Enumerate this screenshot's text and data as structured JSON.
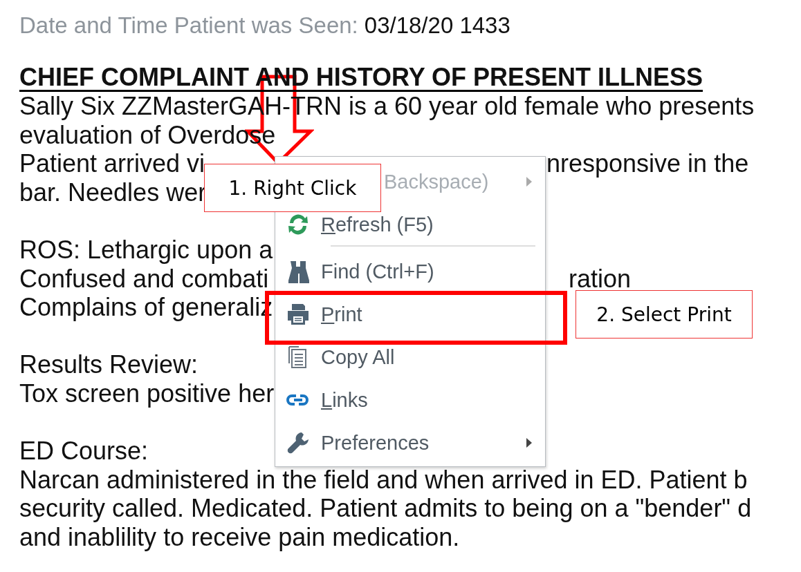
{
  "document": {
    "seen": {
      "label": "Date and Time Patient was Seen:",
      "value": "03/18/20 1433"
    },
    "heading": "CHIEF COMPLAINT AND HISTORY OF PRESENT ILLNESS",
    "lines": [
      {
        "kind": "text",
        "text": "Sally Six ZZMasterGAH-TRN is a 60 year old female who presents"
      },
      {
        "kind": "text",
        "text": "evaluation of Overdose"
      },
      {
        "kind": "text",
        "text": "Patient arrived vi",
        "right": "nresponsive in the"
      },
      {
        "kind": "text",
        "text": "bar. Needles wer"
      },
      {
        "kind": "blank"
      },
      {
        "kind": "text",
        "text": "ROS: Lethargic upon a"
      },
      {
        "kind": "text",
        "text": "Confused and combati",
        "right": "ration"
      },
      {
        "kind": "text",
        "text": "Complains of generaliz"
      },
      {
        "kind": "blank"
      },
      {
        "kind": "text",
        "text": "Results Review:"
      },
      {
        "kind": "text",
        "text": "Tox screen positive her"
      },
      {
        "kind": "blank"
      },
      {
        "kind": "text",
        "text": "ED Course:"
      },
      {
        "kind": "text",
        "text": "Narcan administered in the field and when arrived in ED. Patient b"
      },
      {
        "kind": "text",
        "text": "security called. Medicated. Patient admits to being on a \"bender\" d"
      },
      {
        "kind": "text",
        "text": "and inablility to receive pain medication."
      }
    ]
  },
  "context_menu": {
    "items": [
      {
        "kind": "back",
        "label": "Backspace)",
        "disabled": true,
        "submenu": true,
        "underlined": false,
        "separator_after": false
      },
      {
        "kind": "refresh",
        "label": "Refresh (F5)",
        "disabled": false,
        "submenu": false,
        "underlined": true,
        "separator_after": true
      },
      {
        "kind": "find",
        "label": "Find (Ctrl+F)",
        "disabled": false,
        "submenu": false,
        "underlined": false,
        "separator_after": false
      },
      {
        "kind": "print",
        "label": "Print",
        "disabled": false,
        "submenu": false,
        "underlined": true,
        "separator_after": false
      },
      {
        "kind": "copy",
        "label": "Copy All",
        "disabled": false,
        "submenu": false,
        "underlined": false,
        "separator_after": false
      },
      {
        "kind": "links",
        "label": "Links",
        "disabled": false,
        "submenu": false,
        "underlined": true,
        "separator_after": false
      },
      {
        "kind": "preferences",
        "label": "Preferences",
        "disabled": false,
        "submenu": true,
        "underlined": false,
        "separator_after": false
      }
    ]
  },
  "annotations": [
    {
      "text": "1. Right Click"
    },
    {
      "text": "2. Select Print"
    }
  ]
}
